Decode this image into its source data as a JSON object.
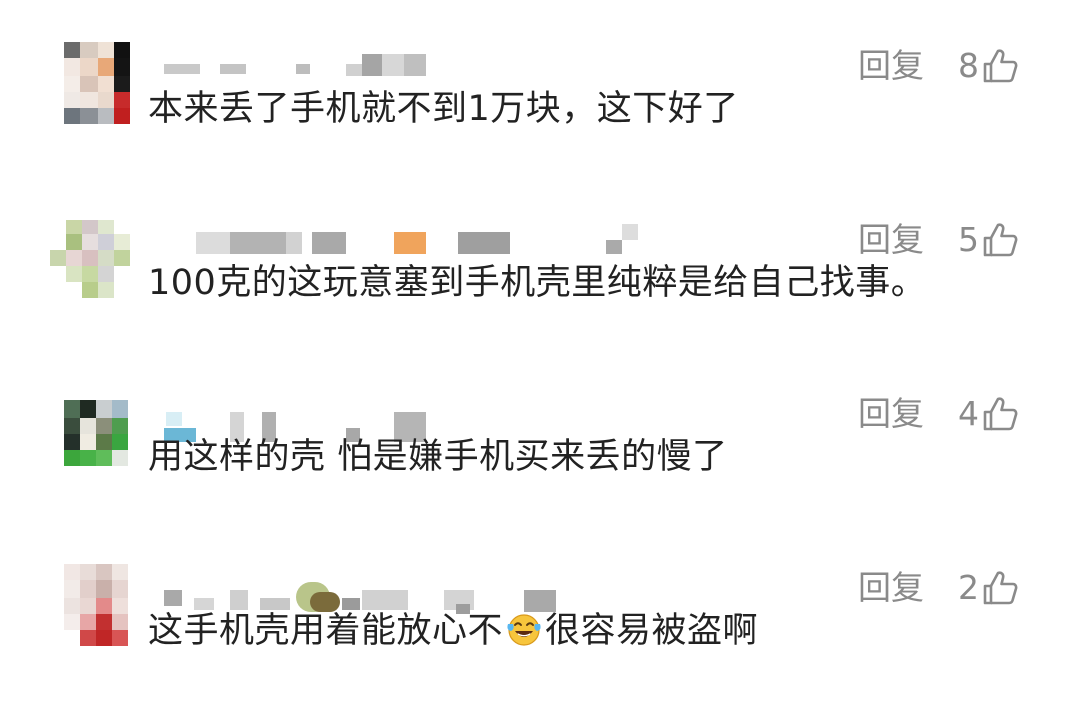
{
  "comments": [
    {
      "text": "本来丢了手机就不到1万块，这下好了",
      "reply_label": "回复",
      "likes": "8"
    },
    {
      "text": "100克的这玩意塞到手机壳里纯粹是给自己找事。",
      "reply_label": "回复",
      "likes": "5"
    },
    {
      "text": "用这样的壳 怕是嫌手机买来丢的慢了",
      "reply_label": "回复",
      "likes": "4"
    },
    {
      "text_before_emoji": "这手机壳用着能放心不",
      "emoji": "tears-of-joy-emoji",
      "text_after_emoji": "很容易被盗啊",
      "reply_label": "回复",
      "likes": "2"
    }
  ],
  "icons": {
    "like": "thumbs-up-outline-icon"
  },
  "colors": {
    "text": "#222222",
    "meta": "#8a8a8a",
    "background": "#ffffff"
  }
}
